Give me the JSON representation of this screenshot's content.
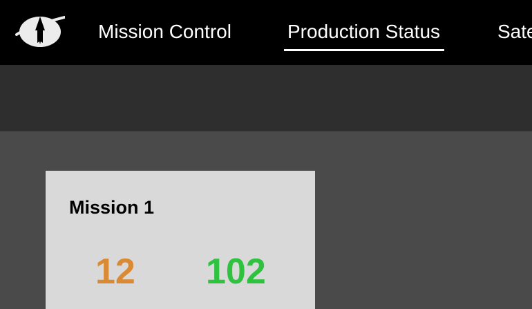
{
  "nav": {
    "items": [
      {
        "label": "Mission Control",
        "active": false
      },
      {
        "label": "Production Status",
        "active": true
      },
      {
        "label": "Satellites",
        "active": false
      }
    ]
  },
  "card": {
    "title": "Mission 1",
    "stat_a": "12",
    "stat_b": "102"
  },
  "colors": {
    "topbar": "#000000",
    "subbar": "#2e2e2e",
    "content": "#4a4a4a",
    "card": "#d9d9d9",
    "stat_a": "#d98a33",
    "stat_b": "#2fc23e"
  },
  "icons": {
    "logo": "rocket-planet-icon"
  }
}
